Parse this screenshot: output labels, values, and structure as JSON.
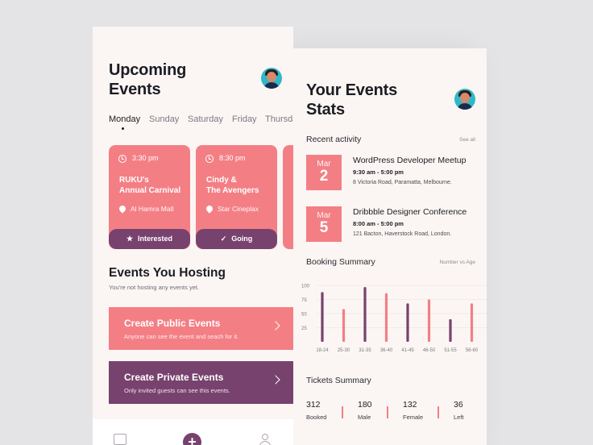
{
  "colors": {
    "pink": "#f37f85",
    "purple": "#78426e",
    "background": "#fbf6f3"
  },
  "stats_screen": {
    "title_line1": "Your Events",
    "title_line2": "Stats",
    "recent_activity": {
      "heading": "Recent activity",
      "see_all": "See all",
      "items": [
        {
          "month": "Mar",
          "day": "2",
          "title": "WordPress Developer Meetup",
          "time": "9:30 am - 5:00 pm",
          "address": "8 Victoria Road, Paramatta, Melbourne."
        },
        {
          "month": "Mar",
          "day": "5",
          "title": "Dribbble Designer Conference",
          "time": "8:00 am - 5:00 pm",
          "address": "121 Bacton, Haverstock Road, London."
        }
      ]
    },
    "booking_summary": {
      "heading": "Booking Summary",
      "filter": "Number vs Age"
    },
    "tickets_summary": {
      "heading": "Tickets Summary",
      "items": [
        {
          "value": "312",
          "label": "Booked"
        },
        {
          "value": "180",
          "label": "Male"
        },
        {
          "value": "132",
          "label": "Female"
        },
        {
          "value": "36",
          "label": "Left"
        }
      ]
    }
  },
  "chart_data": {
    "type": "bar",
    "title": "Booking Summary",
    "categories": [
      "18-24",
      "25-30",
      "31-35",
      "36-40",
      "41-45",
      "46-50",
      "51-55",
      "56-60"
    ],
    "series": [
      {
        "values": [
          88,
          null,
          97,
          null,
          68,
          null,
          40,
          null
        ]
      },
      {
        "values": [
          null,
          58,
          null,
          86,
          null,
          75,
          null,
          68
        ]
      }
    ],
    "y_ticks": [
      25,
      50,
      75,
      100
    ],
    "ylim": [
      0,
      100
    ],
    "grid": true
  },
  "events_screen": {
    "title_line1": "Upcoming",
    "title_line2": "Events",
    "days": [
      "Monday",
      "Sunday",
      "Saturday",
      "Friday",
      "Thursday"
    ],
    "active_day": "Monday",
    "events": [
      {
        "time": "3:30 pm",
        "name_line1": "RUKU's",
        "name_line2": "Annual Carnival",
        "place": "Al Hamra Mall",
        "status": "Interested",
        "status_icon": "star-icon"
      },
      {
        "time": "8:30 pm",
        "name_line1": "Cindy &",
        "name_line2": "The Avengers",
        "place": "Star Cineplax",
        "status": "Going",
        "status_icon": "check-icon"
      }
    ],
    "hosting": {
      "heading": "Events You Hosting",
      "subtext": "You're not hosting any events yet."
    },
    "create_public": {
      "title": "Create Public Events",
      "subtitle": "Anyone can see the event and seach for it."
    },
    "create_private": {
      "title": "Create Private Events",
      "subtitle": "Only invited guests can see this events."
    },
    "nav": {
      "plus": "+"
    }
  }
}
